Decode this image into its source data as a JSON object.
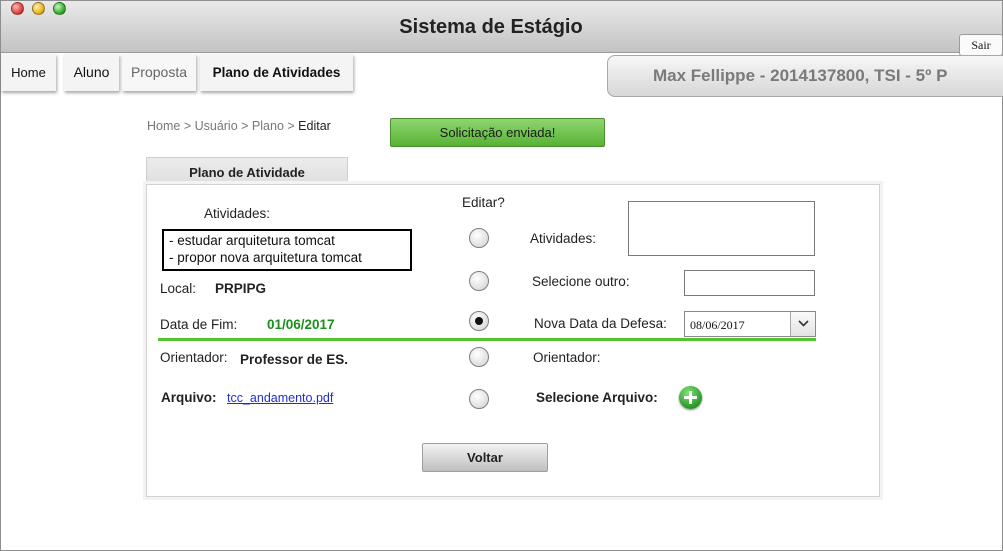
{
  "app": {
    "title": "Sistema de Estágio"
  },
  "toolbar": {
    "sair_label": "Sair"
  },
  "nav": {
    "home": "Home",
    "aluno": "Aluno",
    "proposta": "Proposta",
    "plano": "Plano de Atividades"
  },
  "user": {
    "info": "Max Fellippe - 2014137800, TSI - 5º P"
  },
  "breadcrumb": {
    "home": "Home",
    "sep": " > ",
    "usuario": "Usuário",
    "plano": "Plano",
    "current": "Editar"
  },
  "status": {
    "message": "Solicitação enviada!"
  },
  "tab": {
    "label": "Plano de Atividade"
  },
  "form": {
    "editar_header": "Editar?",
    "atividades_label": "Atividades:",
    "atividades_items": [
      "- estudar arquitetura tomcat",
      "- propor nova arquitetura tomcat"
    ],
    "local_label": "Local:",
    "local_value": "PRPIPG",
    "data_fim_label": "Data de Fim:",
    "data_fim_value": "01/06/2017",
    "orientador_label": "Orientador:",
    "orientador_value": "Professor de ES.",
    "arquivo_label": "Arquivo:",
    "arquivo_value": "tcc_andamento.pdf",
    "right_atividades_label": "Atividades:",
    "selecione_outro_label": "Selecione outro:",
    "nova_data_label": "Nova Data da Defesa:",
    "nova_data_value": "08/06/2017",
    "right_orientador_label": "Orientador:",
    "selecione_arquivo_label": "Selecione Arquivo:",
    "radios": {
      "atividades": false,
      "local": false,
      "data": true,
      "orientador": false,
      "arquivo": false
    }
  },
  "actions": {
    "voltar_label": "Voltar"
  },
  "colors": {
    "accent_green": "#53c430",
    "date_value": "#1a8f1a",
    "link": "#1d2fd6"
  }
}
